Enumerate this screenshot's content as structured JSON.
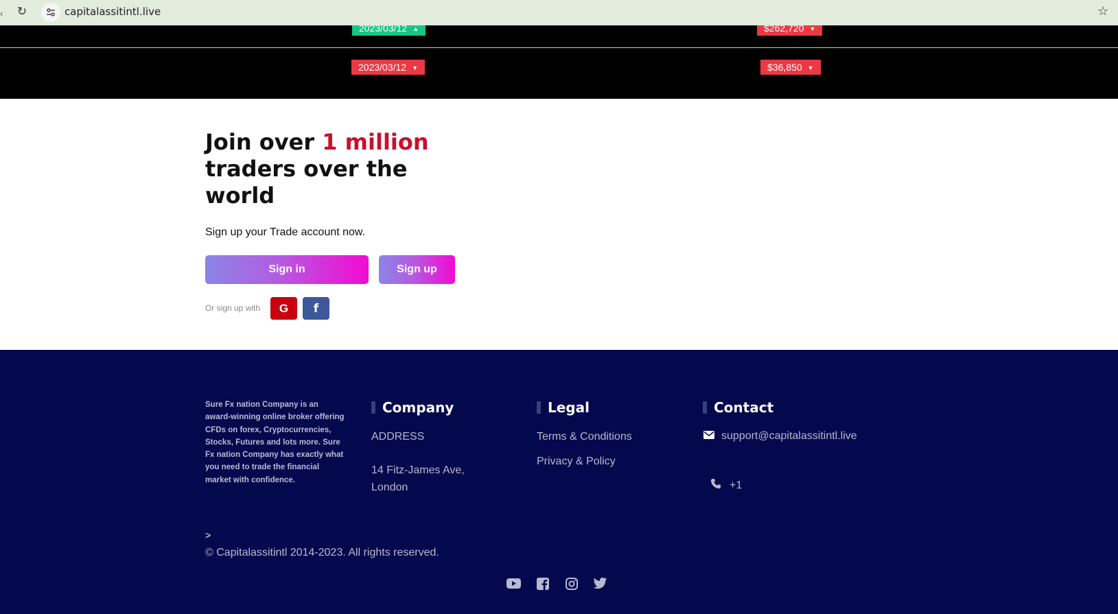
{
  "browser": {
    "url": "capitalassitintl.live"
  },
  "ticker": {
    "rows": [
      {
        "date": "2023/03/12",
        "date_trend": "up",
        "amount": "$262,720",
        "amount_trend": "down"
      },
      {
        "date": "2023/03/12",
        "date_trend": "down",
        "amount": "$36,850",
        "amount_trend": "down"
      }
    ],
    "colors": {
      "up": "#16c784",
      "down": "#ea3943"
    }
  },
  "join": {
    "heading_pre": "Join over ",
    "heading_highlight": "1 million",
    "heading_post": "traders over the world",
    "subtitle": "Sign up your Trade account now.",
    "signin_label": "Sign in",
    "signup_label": "Sign up",
    "or_label": "Or sign up with",
    "google_glyph": "G",
    "facebook_glyph": "f"
  },
  "footer": {
    "about": "Sure Fx nation Company is an award-winning online broker offering CFDs on forex, Cryptocurrencies, Stocks, Futures and lots more. Sure Fx nation Company has exactly what you need to trade the financial market with confidence.",
    "company": {
      "title": "Company",
      "address_label": "ADDRESS",
      "address_line1": "14 Fitz-James Ave,",
      "address_line2": "London"
    },
    "legal": {
      "title": "Legal",
      "terms": "Terms & Conditions",
      "privacy": "Privacy & Policy"
    },
    "contact": {
      "title": "Contact",
      "email": "support@capitalassitintl.live",
      "phone": "+1"
    },
    "gt": ">",
    "copyright": "© Capitalassitintl 2014-2023. All rights reserved.",
    "social_icons": [
      "youtube-icon",
      "facebook-icon",
      "instagram-icon",
      "twitter-icon"
    ]
  }
}
